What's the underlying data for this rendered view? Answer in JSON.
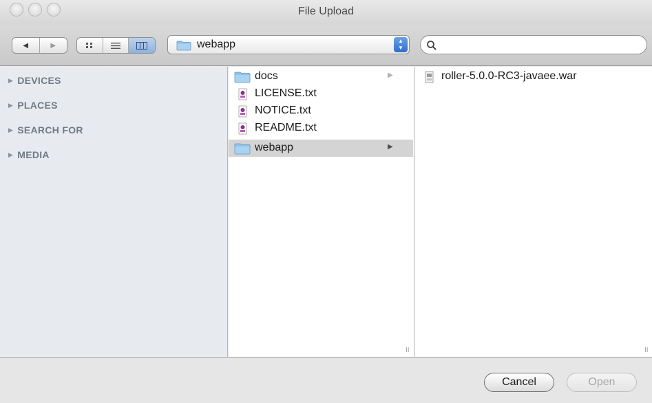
{
  "window": {
    "title": "File Upload"
  },
  "toolbar": {
    "back_glyph": "◀",
    "forward_glyph": "▶",
    "view_icon_glyph": "⠿",
    "view_list_glyph": "≡",
    "view_columns_glyph": "◫",
    "path_popup_value": "webapp",
    "path_popup_arrows": "▲▼"
  },
  "search": {
    "value": "",
    "placeholder": ""
  },
  "sidebar": {
    "items": [
      {
        "label": "DEVICES",
        "icon": "disclosure-triangle"
      },
      {
        "label": "PLACES",
        "icon": "disclosure-triangle"
      },
      {
        "label": "SEARCH FOR",
        "icon": "disclosure-triangle"
      },
      {
        "label": "MEDIA",
        "icon": "disclosure-triangle"
      }
    ]
  },
  "browser": {
    "column1": [
      {
        "name": "docs",
        "icon": "folder-icon",
        "has_children": true,
        "selected": false
      },
      {
        "name": "LICENSE.txt",
        "icon": "text-document-icon",
        "has_children": false,
        "selected": false
      },
      {
        "name": "NOTICE.txt",
        "icon": "text-document-icon",
        "has_children": false,
        "selected": false
      },
      {
        "name": "README.txt",
        "icon": "text-document-icon",
        "has_children": false,
        "selected": false
      },
      {
        "name": "webapp",
        "icon": "folder-icon",
        "has_children": true,
        "selected": true
      }
    ],
    "column2": [
      {
        "name": "roller-5.0.0-RC3-javaee.war",
        "icon": "archive-file-icon"
      }
    ],
    "chevron_glyph": "▶",
    "resize_glyph": "II"
  },
  "buttons": {
    "cancel_label": "Cancel",
    "open_label": "Open"
  },
  "colors": {
    "selection_gray": "#d4d4d4",
    "sidebar_bg": "#e7ebf0",
    "accent_blue": "#2f6fd0",
    "folder_blue": "#8fc3ea"
  }
}
